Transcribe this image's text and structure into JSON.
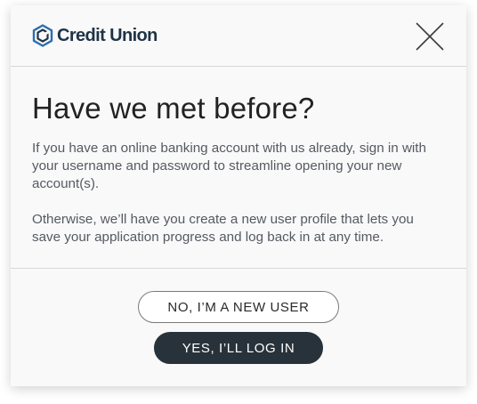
{
  "brand": {
    "name": "Credit Union",
    "logo_icon": "hexagon-c-logo-icon",
    "color": "#1f3347"
  },
  "header": {
    "close_icon": "close-icon"
  },
  "dialog": {
    "title": "Have we met before?",
    "paragraph_1": "If you have an online banking account with us already, sign in with your username and password to streamline opening your new account(s).",
    "paragraph_2": "Otherwise, we’ll have you create a new user profile that lets you save your application progress and log back in at any time."
  },
  "actions": {
    "new_user_label": "NO, I’M A NEW USER",
    "login_label": "YES, I’LL LOG IN"
  },
  "colors": {
    "primary_button": "#28323a",
    "text_body": "#555a61",
    "background": "#f9f9f9"
  }
}
